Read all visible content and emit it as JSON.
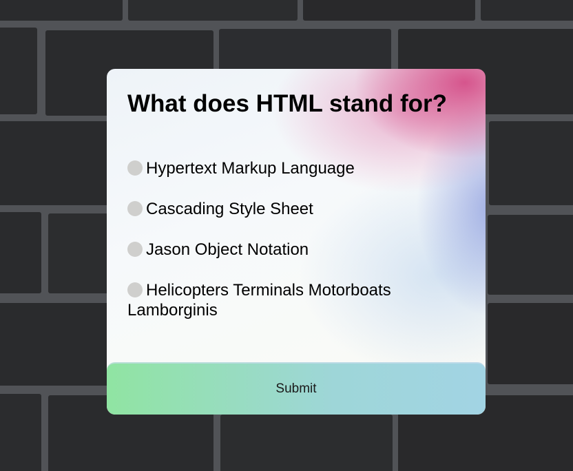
{
  "quiz": {
    "question": "What does HTML stand for?",
    "options": [
      {
        "label": "Hypertext Markup Language"
      },
      {
        "label": "Cascading Style Sheet"
      },
      {
        "label": "Jason Object Notation"
      },
      {
        "label": "Helicopters Terminals Motorboats Lamborginis"
      }
    ],
    "submit_label": "Submit"
  },
  "colors": {
    "submit_gradient_start": "#90e4a2",
    "submit_gradient_end": "#a2d4e4",
    "radio_fill": "#cfcfcd",
    "wall_brick": "#2a2b2d",
    "wall_mortar": "#54565a"
  }
}
